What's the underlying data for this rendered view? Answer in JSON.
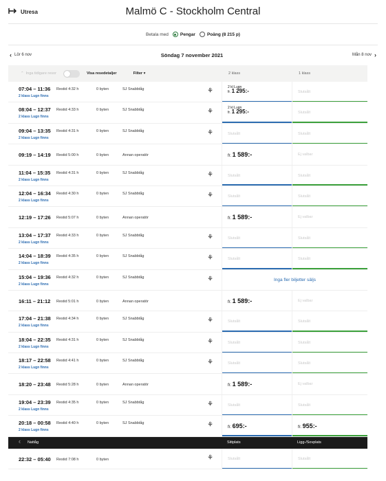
{
  "header": {
    "trip_label": "Utresa",
    "route": "Malmö C - Stockholm Central"
  },
  "payment": {
    "label": "Betala med",
    "option_money": "Pengar",
    "option_points": "Poäng (8 215 p)"
  },
  "dates": {
    "prev": "Lör 6 nov",
    "current": "Söndag 7 november 2021",
    "next": "Mån 8 nov"
  },
  "table_header": {
    "hint": "Inga tidigare resor",
    "details_label": "Visa resedetaljer",
    "filter_label": "Filter",
    "class2": "2 klass",
    "class1": "1 klass"
  },
  "colors": {
    "blue": "#2a6bb0",
    "green": "#3aa03a"
  },
  "rows": [
    {
      "time": "07:04 – 11:36",
      "sub": "2 klass Lugn finns",
      "dur": "Restid 4:32 h",
      "chg": "0 byten",
      "op": "SJ Snabbtåg",
      "logo": true,
      "c2": {
        "type": "tl",
        "line1": "2 kl Lugn",
        "pre": "fr. ",
        "price": "1 295:-",
        "bar": "blue"
      },
      "c1": {
        "type": "st",
        "text": "Slutsålt",
        "bar": "green"
      }
    },
    {
      "time": "08:04 – 12:37",
      "sub": "2 klass Lugn finns",
      "dur": "Restid 4:33 h",
      "chg": "0 byten",
      "op": "SJ Snabbtåg",
      "logo": true,
      "c2": {
        "type": "tl",
        "line1": "2 kl Lugn",
        "pre": "fr. ",
        "price": "1 295:-",
        "bar": "blue"
      },
      "c1": {
        "type": "st",
        "text": "Slutsålt",
        "bar": "green"
      }
    },
    {
      "time": "09:04 – 13:35",
      "sub": "2 klass Lugn finns",
      "dur": "Restid 4:31 h",
      "chg": "0 byten",
      "op": "SJ Snabbtåg",
      "logo": true,
      "c2": {
        "type": "st",
        "text": "Slutsålt",
        "bar": "blue"
      },
      "c1": {
        "type": "st",
        "text": "Slutsålt",
        "bar": "green"
      }
    },
    {
      "time": "09:19 – 14:19",
      "sub": "",
      "dur": "Restid 5:00 h",
      "chg": "0 byten",
      "op": "Annan operatör",
      "logo": false,
      "c2": {
        "type": "price",
        "pre": "fr. ",
        "price": "1 589:-",
        "bar": ""
      },
      "c1": {
        "type": "st",
        "text": "Ej valbar",
        "bar": ""
      }
    },
    {
      "time": "11:04 – 15:35",
      "sub": "2 klass Lugn finns",
      "dur": "Restid 4:31 h",
      "chg": "0 byten",
      "op": "SJ Snabbtåg",
      "logo": true,
      "c2": {
        "type": "st",
        "text": "Slutsålt",
        "bar": "blue"
      },
      "c1": {
        "type": "st",
        "text": "Slutsålt",
        "bar": "green"
      }
    },
    {
      "time": "12:04 – 16:34",
      "sub": "2 klass Lugn finns",
      "dur": "Restid 4:30 h",
      "chg": "0 byten",
      "op": "SJ Snabbtåg",
      "logo": true,
      "c2": {
        "type": "st",
        "text": "Slutsålt",
        "bar": "blue"
      },
      "c1": {
        "type": "st",
        "text": "Slutsålt",
        "bar": "green"
      }
    },
    {
      "time": "12:19 – 17:26",
      "sub": "",
      "dur": "Restid 5:07 h",
      "chg": "0 byten",
      "op": "Annan operatör",
      "logo": false,
      "c2": {
        "type": "price",
        "pre": "fr. ",
        "price": "1 589:-",
        "bar": ""
      },
      "c1": {
        "type": "st",
        "text": "Ej valbar",
        "bar": ""
      }
    },
    {
      "time": "13:04 – 17:37",
      "sub": "2 klass Lugn finns",
      "dur": "Restid 4:33 h",
      "chg": "0 byten",
      "op": "SJ Snabbtåg",
      "logo": true,
      "c2": {
        "type": "st",
        "text": "Slutsålt",
        "bar": "blue"
      },
      "c1": {
        "type": "st",
        "text": "Slutsålt",
        "bar": "green"
      }
    },
    {
      "time": "14:04 – 18:39",
      "sub": "2 klass Lugn finns",
      "dur": "Restid 4:35 h",
      "chg": "0 byten",
      "op": "SJ Snabbtåg",
      "logo": true,
      "c2": {
        "type": "st",
        "text": "Slutsålt",
        "bar": "blue"
      },
      "c1": {
        "type": "st",
        "text": "Slutsålt",
        "bar": "green"
      }
    },
    {
      "time": "15:04 – 19:36",
      "sub": "2 klass Lugn finns",
      "dur": "Restid 4:32 h",
      "chg": "0 byten",
      "op": "SJ Snabbtåg",
      "logo": true,
      "merged": "Inga fler biljetter säljs"
    },
    {
      "time": "16:11 – 21:12",
      "sub": "",
      "dur": "Restid 5:01 h",
      "chg": "0 byten",
      "op": "Annan operatör",
      "logo": false,
      "c2": {
        "type": "price",
        "pre": "fr. ",
        "price": "1 589:-",
        "bar": ""
      },
      "c1": {
        "type": "st",
        "text": "Ej valbar",
        "bar": ""
      }
    },
    {
      "time": "17:04 – 21:38",
      "sub": "2 klass Lugn finns",
      "dur": "Restid 4:34 h",
      "chg": "0 byten",
      "op": "SJ Snabbtåg",
      "logo": true,
      "c2": {
        "type": "st",
        "text": "Slutsålt",
        "bar": "blue"
      },
      "c1": {
        "type": "st",
        "text": "Slutsålt",
        "bar": "green"
      }
    },
    {
      "time": "18:04 – 22:35",
      "sub": "2 klass Lugn finns",
      "dur": "Restid 4:31 h",
      "chg": "0 byten",
      "op": "SJ Snabbtåg",
      "logo": true,
      "c2": {
        "type": "st",
        "text": "Slutsålt",
        "bar": "blue"
      },
      "c1": {
        "type": "st",
        "text": "Slutsålt",
        "bar": "green"
      }
    },
    {
      "time": "18:17 – 22:58",
      "sub": "2 klass Lugn finns",
      "dur": "Restid 4:41 h",
      "chg": "0 byten",
      "op": "SJ Snabbtåg",
      "logo": true,
      "c2": {
        "type": "st",
        "text": "Slutsålt",
        "bar": "blue"
      },
      "c1": {
        "type": "st",
        "text": "Slutsålt",
        "bar": "green"
      }
    },
    {
      "time": "18:20 – 23:48",
      "sub": "",
      "dur": "Restid 5:28 h",
      "chg": "0 byten",
      "op": "Annan operatör",
      "logo": false,
      "c2": {
        "type": "price",
        "pre": "fr. ",
        "price": "1 589:-",
        "bar": ""
      },
      "c1": {
        "type": "st",
        "text": "Ej valbar",
        "bar": ""
      }
    },
    {
      "time": "19:04 – 23:39",
      "sub": "2 klass Lugn finns",
      "dur": "Restid 4:35 h",
      "chg": "0 byten",
      "op": "SJ Snabbtåg",
      "logo": true,
      "c2": {
        "type": "st",
        "text": "Slutsålt",
        "bar": "blue"
      },
      "c1": {
        "type": "st",
        "text": "Slutsålt",
        "bar": "green"
      }
    },
    {
      "time": "20:18 – 00:58",
      "sub": "2 klass Lugn finns",
      "dur": "Restid 4:40 h",
      "chg": "0 byten",
      "op": "SJ Snabbtåg",
      "logo": true,
      "c2": {
        "type": "price",
        "pre": "fr. ",
        "price": "695:-",
        "bar": "blue"
      },
      "c1": {
        "type": "price",
        "pre": "fr. ",
        "price": "955:-",
        "bar": "green"
      }
    }
  ],
  "night": {
    "label": "Nattåg",
    "col2": "Sittplats",
    "col1": "Ligg-/Sovplats",
    "rows": [
      {
        "time": "22:32 – 05:40",
        "sub": "",
        "dur": "Restid 7:08 h",
        "chg": "0 byten",
        "op": "",
        "logo": true,
        "c2": {
          "type": "st",
          "text": "Slutsålt",
          "bar": "blue"
        },
        "c1": {
          "type": "st",
          "text": "Slutsålt",
          "bar": "green"
        }
      }
    ]
  }
}
